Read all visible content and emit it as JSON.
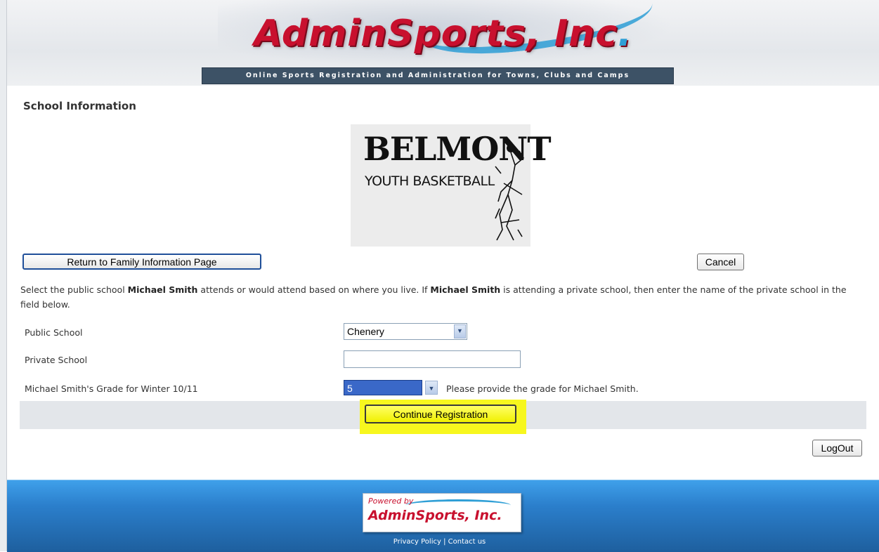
{
  "header": {
    "logo_name": "AdminSports, Inc",
    "logo_dot": ".",
    "tagline": "Online Sports Registration and Administration for Towns, Clubs and Camps"
  },
  "page": {
    "title": "School Information"
  },
  "org_logo": {
    "line1": "BELMONT",
    "line2": "YOUTH BASKETBALL"
  },
  "nav": {
    "return_label": "Return to Family Information Page",
    "cancel_label": "Cancel",
    "logout_label": "LogOut"
  },
  "instructions": {
    "part1": "Select the public school ",
    "name1": "Michael Smith",
    "part2": " attends or would attend based on where you live. If ",
    "name2": "Michael Smith",
    "part3": " is attending a private school, then enter the name of the private school in the field below."
  },
  "form": {
    "public_school_label": "Public School",
    "public_school_value": "Chenery",
    "private_school_label": "Private School",
    "private_school_value": "",
    "grade_label": "Michael Smith's Grade for Winter 10/11",
    "grade_value": "5",
    "grade_hint": "Please provide the grade for Michael Smith.",
    "continue_label": "Continue Registration"
  },
  "footer": {
    "powered_by": "Powered by",
    "powered_name": "AdminSports, Inc.",
    "privacy_label": "Privacy Policy",
    "separator": " | ",
    "contact_label": "Contact us"
  },
  "colors": {
    "brand_red": "#c8102e",
    "brand_blue": "#2f9fd6",
    "highlight_yellow": "#f7f71e",
    "footer_blue": "#2b7fcc"
  }
}
